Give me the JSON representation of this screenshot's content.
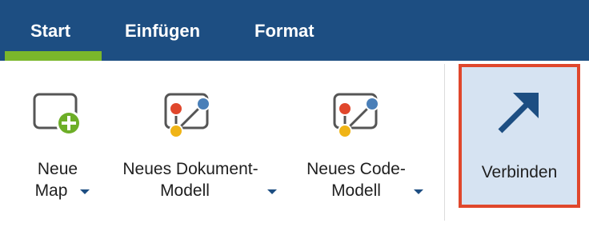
{
  "tabs": {
    "start": "Start",
    "einfuegen": "Einfügen",
    "format": "Format"
  },
  "ribbon": {
    "new_map": {
      "line1": "Neue",
      "line2": "Map",
      "icon": "new-map-icon"
    },
    "new_doc_model": {
      "line1": "Neues Dokument-",
      "line2": "Modell",
      "icon": "document-model-icon"
    },
    "new_code_model": {
      "line1": "Neues Code-",
      "line2": "Modell",
      "icon": "code-model-icon"
    },
    "connect": {
      "label": "Verbinden",
      "icon": "arrow-up-right-icon"
    }
  },
  "colors": {
    "tabbar": "#1d4e82",
    "active_tab_underline": "#7ab72b",
    "highlight_border": "#e0472c",
    "highlight_fill": "#d6e3f2"
  }
}
